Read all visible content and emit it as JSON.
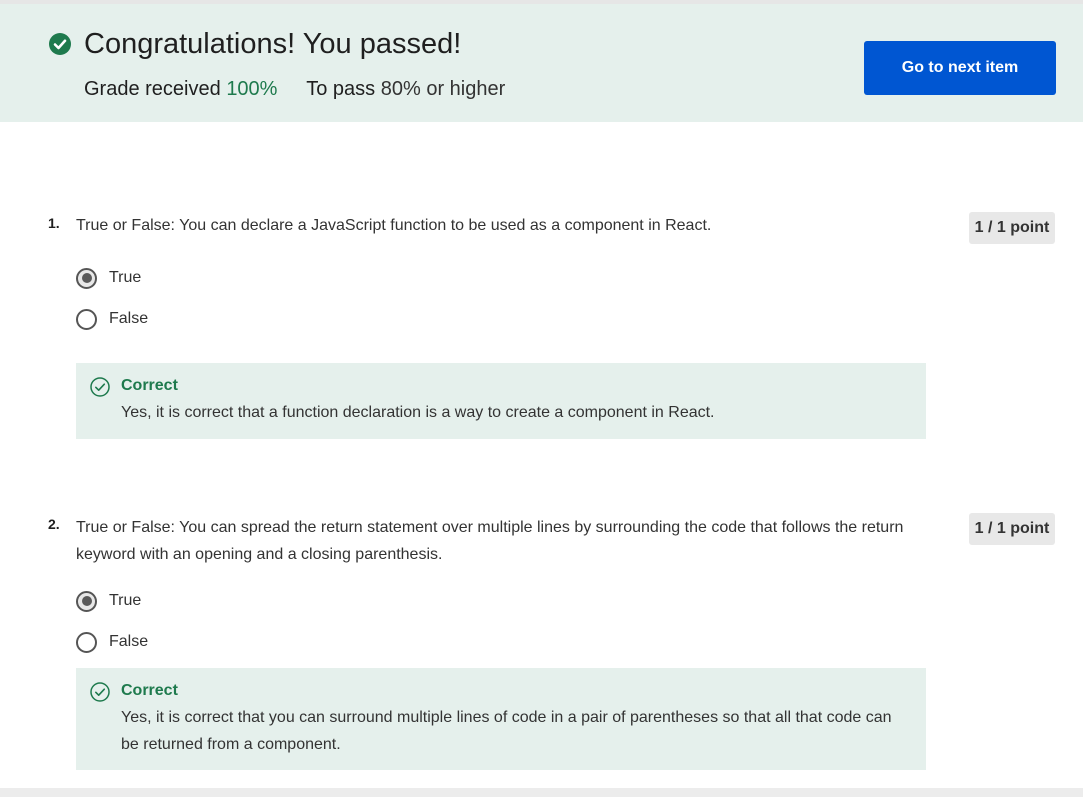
{
  "banner": {
    "title": "Congratulations! You passed!",
    "grade_label": "Grade received",
    "grade_value": "100%",
    "pass_label": "To pass",
    "pass_value": "80% or higher",
    "next_button": "Go to next item"
  },
  "questions": [
    {
      "number": "1.",
      "text": "True or False: You can declare a JavaScript function to be used as a component in React.",
      "points": "1 / 1 point",
      "options": [
        {
          "label": "True",
          "selected": true
        },
        {
          "label": "False",
          "selected": false
        }
      ],
      "feedback": {
        "status": "Correct",
        "text": "Yes, it is correct that a function declaration is a way to create a component in React."
      }
    },
    {
      "number": "2.",
      "text": "True or False: You can spread the return statement over multiple lines by surrounding the code that follows the return keyword with an opening and a closing parenthesis.",
      "points": "1 / 1 point",
      "options": [
        {
          "label": "True",
          "selected": true
        },
        {
          "label": "False",
          "selected": false
        }
      ],
      "feedback": {
        "status": "Correct",
        "text": "Yes, it is correct that you can surround multiple lines of code in a pair of parentheses so that all that code can be returned from a component."
      }
    }
  ],
  "colors": {
    "banner_bg": "#e5f0ec",
    "success_green": "#1e7a4d",
    "primary_blue": "#0056d2"
  },
  "icons": {
    "banner": "check-circle-filled-icon",
    "feedback": "check-circle-outline-icon"
  }
}
